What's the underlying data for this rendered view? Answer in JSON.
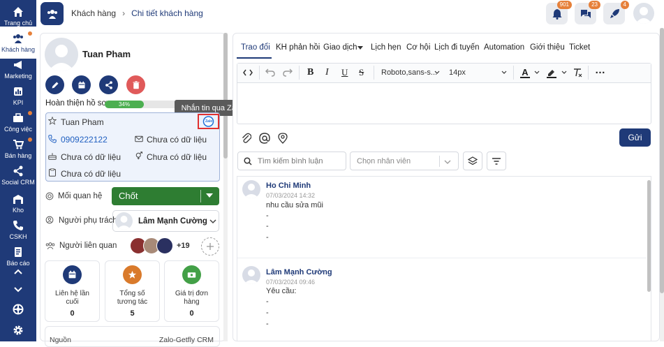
{
  "sidebar": {
    "items": [
      {
        "label": "Trang chủ",
        "icon": "home-icon"
      },
      {
        "label": "Khách hàng",
        "icon": "customers-icon"
      },
      {
        "label": "Marketing",
        "icon": "megaphone-icon"
      },
      {
        "label": "KPI",
        "icon": "chart-icon"
      },
      {
        "label": "Công việc",
        "icon": "briefcase-icon"
      },
      {
        "label": "Bán hàng",
        "icon": "cart-icon"
      },
      {
        "label": "Social CRM",
        "icon": "share-icon"
      },
      {
        "label": "Kho",
        "icon": "warehouse-icon"
      },
      {
        "label": "CSKH",
        "icon": "phone-icon"
      },
      {
        "label": "Báo cáo",
        "icon": "report-icon"
      }
    ]
  },
  "header": {
    "breadcrumb_root": "Khách hàng",
    "breadcrumb_current": "Chi tiết khách hàng",
    "badges": {
      "notifications": "901",
      "messages": "23",
      "rocket": "4"
    }
  },
  "customer": {
    "name": "Tuan Pham",
    "progress_label": "Hoàn thiện hồ sơ",
    "progress_value": "34%",
    "progress_fraction": 0.34,
    "tooltip": "Nhắn tin qua Zalo",
    "zalo_label": "Zalo",
    "contact_name": "Tuan Pham",
    "phone": "0909222122",
    "email": "Chưa có dữ liệu",
    "birthday": "Chưa có dữ liệu",
    "gender": "Chưa có dữ liệu",
    "note": "Chưa có dữ liệu",
    "relation_label": "Mối quan hệ",
    "relation_value": "Chốt",
    "owner_label": "Người phụ trách",
    "owner_value": "Lâm Mạnh Cường",
    "related_label": "Người liên quan",
    "related_more": "+19",
    "stats": [
      {
        "label": "Liên hệ lần cuối",
        "value": "0"
      },
      {
        "label": "Tổng số tương tác",
        "value": "5"
      },
      {
        "label": "Giá trị đơn hàng",
        "value": "0"
      }
    ],
    "source_label": "Nguồn",
    "source_value": "Zalo-Getfly CRM"
  },
  "tabs": [
    "Trao đổi",
    "KH phản hồi",
    "Giao dịch",
    "Lịch hẹn",
    "Cơ hội",
    "Lịch đi tuyến",
    "Automation",
    "Giới thiệu",
    "Ticket"
  ],
  "editor": {
    "font": "Roboto,sans-s...",
    "size": "14px",
    "send": "Gửi"
  },
  "filters": {
    "search_placeholder": "Tìm kiếm bình luận",
    "staff_placeholder": "Chọn nhân viên"
  },
  "comments": [
    {
      "author": "Ho Chi Minh",
      "time": "07/03/2024 14:32",
      "lines": [
        "nhu cầu sửa mũi",
        "-",
        "-",
        "-"
      ]
    },
    {
      "author": "Lâm Mạnh Cường",
      "time": "07/03/2024 09:46",
      "lines": [
        "Yêu cầu:",
        "-",
        "-",
        "-"
      ]
    }
  ],
  "colors": {
    "sidebar": "#1f3a78",
    "accent": "#e6803a",
    "relation": "#2e7d32",
    "danger": "#e05a5a"
  }
}
